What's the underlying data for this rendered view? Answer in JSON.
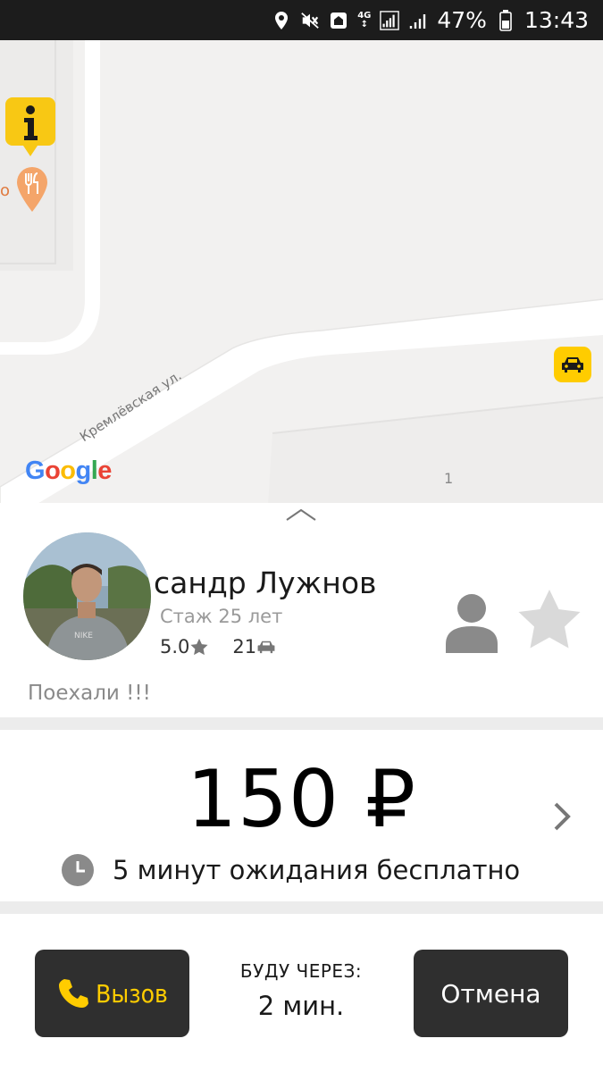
{
  "status_bar": {
    "network_label_top": "4G",
    "network_label_bottom": "↕",
    "battery": "47%",
    "time": "13:43",
    "icons": [
      "location-icon",
      "mute-icon",
      "home-icon",
      "network-4g-icon",
      "signal-icon",
      "battery-icon"
    ]
  },
  "map": {
    "street_label": "Кремлёвская ул.",
    "house_number": "1",
    "google_logo": {
      "g1": "G",
      "o1": "o",
      "o2": "o",
      "g2": "g",
      "l": "l",
      "e": "e"
    },
    "poi_edge_text": "о",
    "markers": [
      "info-marker",
      "restaurant-marker",
      "taxi-car-marker"
    ],
    "accent": "#ffcc00",
    "restaurant_color": "#f4a460"
  },
  "driver": {
    "name": "сандр Лужнов",
    "experience": "Стаж 25 лет",
    "rating": "5.0",
    "trips": "21",
    "comment": "Поехали !!!"
  },
  "fare": {
    "price": "150 ₽",
    "wait_info": "5 минут ожидания бесплатно"
  },
  "actions": {
    "call_label": "Вызов",
    "eta_title": "БУДУ ЧЕРЕЗ:",
    "eta_value": "2 мин.",
    "cancel_label": "Отмена"
  },
  "colors": {
    "brand_yellow": "#ffcc00",
    "button_dark": "#2f2f2f",
    "status_bar": "#1c1c1c"
  }
}
